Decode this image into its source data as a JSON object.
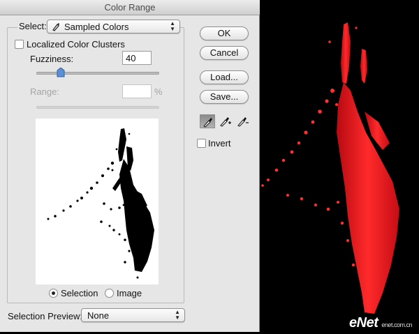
{
  "window": {
    "title": "Color Range"
  },
  "select": {
    "label": "Select:",
    "value": "Sampled Colors"
  },
  "localized": {
    "label": "Localized Color Clusters",
    "checked": false
  },
  "fuzziness": {
    "label": "Fuzziness:",
    "value": "40",
    "level_percent": 20
  },
  "range": {
    "label": "Range:",
    "value": "",
    "unit": "%"
  },
  "view": {
    "selection_label": "Selection",
    "image_label": "Image",
    "selected": "Selection"
  },
  "preview_mode": {
    "label": "Selection Preview:",
    "value": "None"
  },
  "buttons": {
    "ok": "OK",
    "cancel": "Cancel",
    "load": "Load...",
    "save": "Save..."
  },
  "tools": [
    "eyedropper-icon",
    "eyedropper-plus-icon",
    "eyedropper-minus-icon"
  ],
  "invert": {
    "label": "Invert",
    "checked": false
  },
  "watermark": {
    "main": "eNet",
    "sub": "enet.com.cn"
  },
  "colors": {
    "splash_red": "#e8121c",
    "background": "#000000",
    "dialog": "#e6e6e6"
  }
}
